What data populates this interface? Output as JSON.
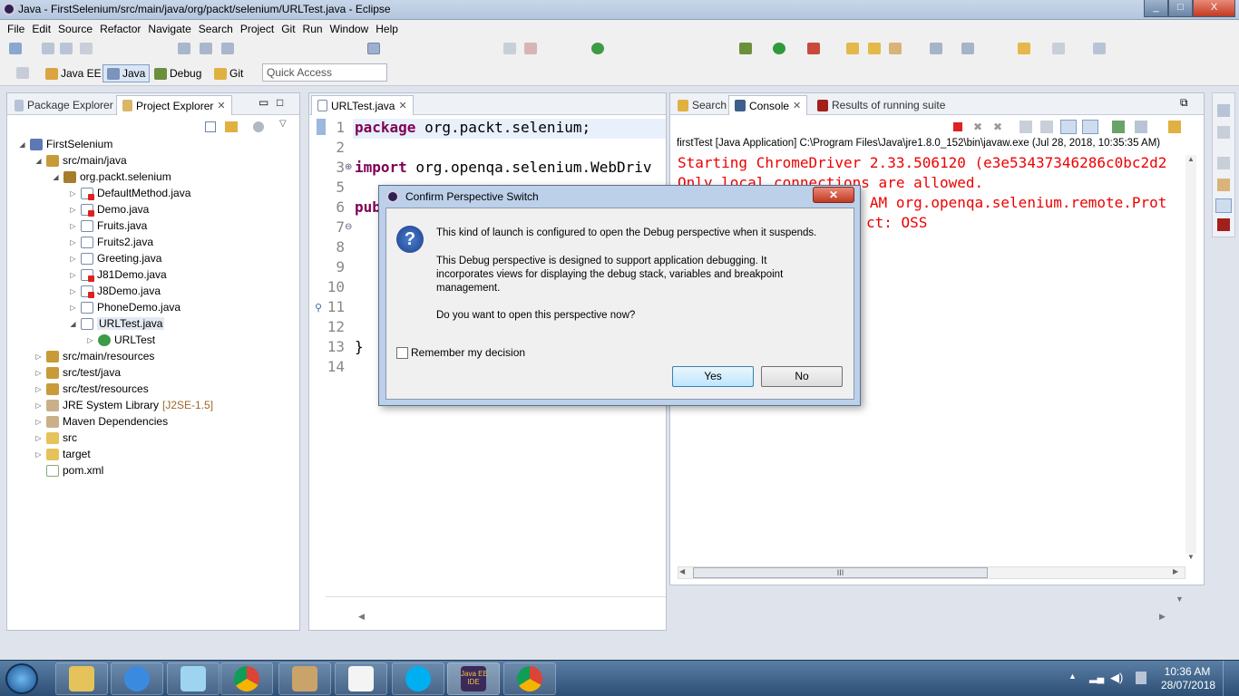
{
  "window": {
    "title": "Java - FirstSelenium/src/main/java/org/packt/selenium/URLTest.java - Eclipse",
    "minimize": "_",
    "maximize": "□",
    "close": "X"
  },
  "menu": [
    "File",
    "Edit",
    "Source",
    "Refactor",
    "Navigate",
    "Search",
    "Project",
    "Git",
    "Run",
    "Window",
    "Help"
  ],
  "perspectives": [
    {
      "label": "Java EE"
    },
    {
      "label": "Java",
      "selected": true
    },
    {
      "label": "Debug"
    },
    {
      "label": "Git"
    }
  ],
  "quick_access": "Quick Access",
  "explorer": {
    "tabs": [
      {
        "label": "Package Explorer"
      },
      {
        "label": "Project Explorer",
        "active": true
      }
    ],
    "tree": [
      {
        "label": "FirstSelenium",
        "icon": "project-icon"
      },
      {
        "label": "src/main/java",
        "icon": "source-folder-icon"
      },
      {
        "label": "org.packt.selenium",
        "icon": "package-icon"
      },
      {
        "label": "DefaultMethod.java",
        "icon": "java-file-error-icon"
      },
      {
        "label": "Demo.java",
        "icon": "java-file-error-icon"
      },
      {
        "label": "Fruits.java",
        "icon": "java-file-icon"
      },
      {
        "label": "Fruits2.java",
        "icon": "java-file-icon"
      },
      {
        "label": "Greeting.java",
        "icon": "java-file-icon"
      },
      {
        "label": "J81Demo.java",
        "icon": "java-file-error-icon"
      },
      {
        "label": "J8Demo.java",
        "icon": "java-file-error-icon"
      },
      {
        "label": "PhoneDemo.java",
        "icon": "java-file-icon"
      },
      {
        "label": "URLTest.java",
        "icon": "java-file-icon"
      },
      {
        "label": "URLTest",
        "icon": "class-icon"
      },
      {
        "label": "src/main/resources",
        "icon": "source-folder-icon"
      },
      {
        "label": "src/test/java",
        "icon": "source-folder-icon"
      },
      {
        "label": "src/test/resources",
        "icon": "source-folder-icon"
      },
      {
        "label": "JRE System Library",
        "suffix": "[J2SE-1.5]",
        "icon": "library-icon"
      },
      {
        "label": "Maven Dependencies",
        "icon": "library-icon"
      },
      {
        "label": "src",
        "icon": "folder-icon"
      },
      {
        "label": "target",
        "icon": "folder-icon"
      },
      {
        "label": "pom.xml",
        "icon": "xml-file-icon"
      }
    ]
  },
  "editor": {
    "tab": "URLTest.java",
    "line_numbers": [
      "1",
      "2",
      "3",
      "5",
      "6",
      "7",
      "8",
      "9",
      "10",
      "11",
      "12",
      "13",
      "14"
    ],
    "lines": [
      {
        "kw": "package",
        "rest": " org.packt.selenium;"
      },
      {
        "kw": "import",
        "rest": " org.openqa.selenium.WebDriv"
      },
      {
        "kw": "pub",
        "rest": ""
      },
      {
        "kw": "",
        "rest": "}"
      }
    ]
  },
  "console": {
    "tabs": [
      {
        "label": "Search"
      },
      {
        "label": "Console",
        "active": true
      },
      {
        "label": "Results of running suite"
      }
    ],
    "launch": "firstTest [Java Application] C:\\Program Files\\Java\\jre1.8.0_152\\bin\\javaw.exe (Jul 28, 2018, 10:35:35 AM)",
    "output": [
      "Starting ChromeDriver 2.33.506120 (e3e53437346286c0bc2d2",
      "Only local connections are allowed.",
      "Jul 28, 2018 10:35:38 AM org.openqa.selenium.remote.Prot",
      "ct: OSS"
    ],
    "scrollbar_grip": "III"
  },
  "dialog": {
    "title": "Confirm Perspective Switch",
    "line1": "This kind of launch is configured to open the Debug perspective when it suspends.",
    "line2": "This Debug perspective is designed to support application debugging.  It",
    "line3": "incorporates views for displaying the debug stack, variables and breakpoint",
    "line4": "management.",
    "question": "Do you want to open this perspective now?",
    "checkbox_label": "Remember my decision",
    "checked": false,
    "yes": "Yes",
    "no": "No"
  },
  "taskbar": {
    "clock_time": "10:36 AM",
    "clock_date": "28/07/2018",
    "badge": "Java EE\nIDE"
  },
  "colors": {
    "accent": "#3c7fb1",
    "console_error": "#e00000",
    "keyword": "#7f0055"
  }
}
